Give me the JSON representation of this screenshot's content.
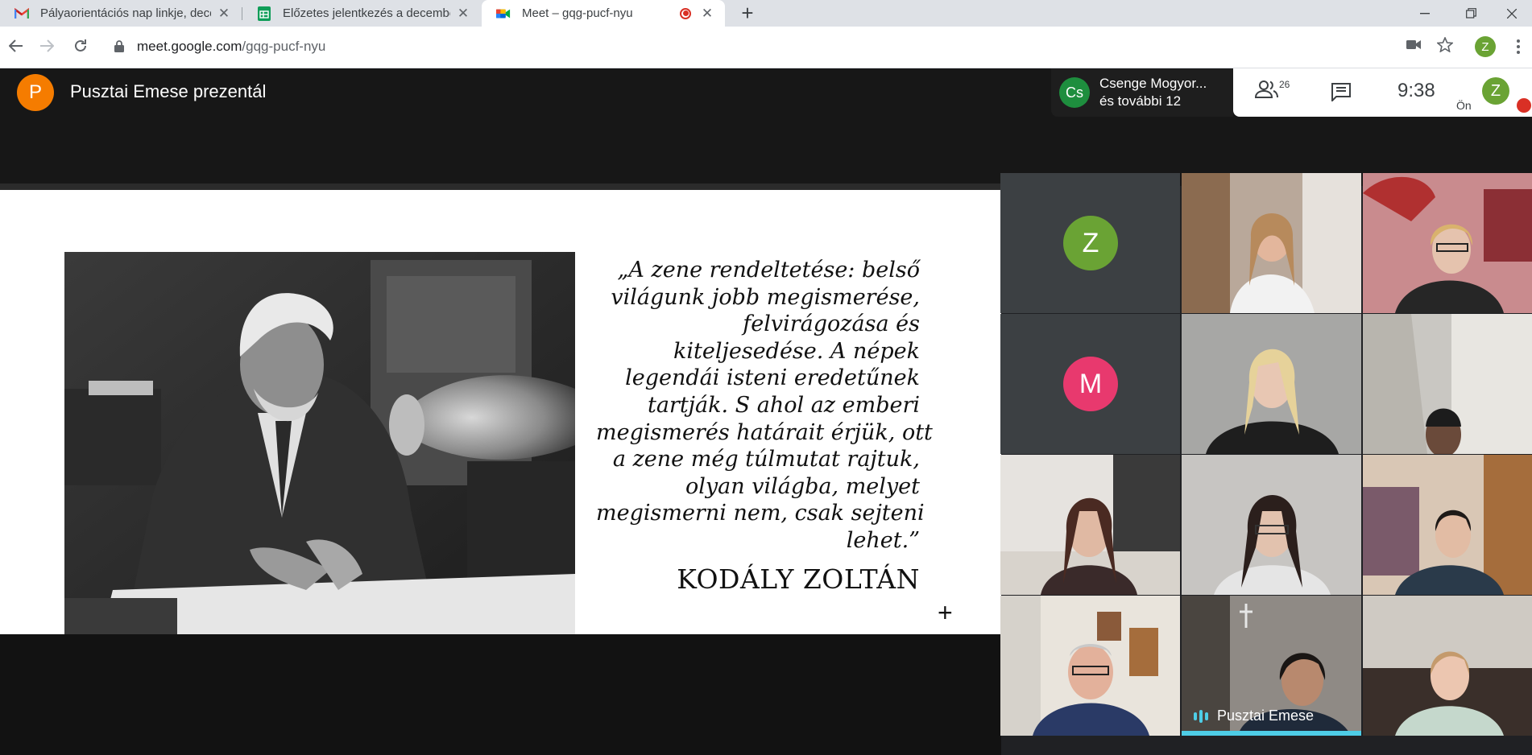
{
  "browser": {
    "tabs": [
      {
        "title": "Pályaorientációs nap linkje, decem",
        "favicon": "gmail-icon"
      },
      {
        "title": "Előzetes jelentkezés a december",
        "favicon": "sheets-icon"
      },
      {
        "title": "Meet – gqg-pucf-nyu",
        "favicon": "meet-icon",
        "recording": true,
        "active": true
      }
    ],
    "url_host": "meet.google.com",
    "url_path": "/gqg-pucf-nyu",
    "profile_initial": "Z"
  },
  "meet": {
    "presenter_initial": "P",
    "presenter_title": "Pusztai Emese prezentál",
    "chip": {
      "initials": "Cs",
      "line1": "Csenge Mogyor...",
      "line2": "és további 12"
    },
    "participant_count": "26",
    "time": "9:38",
    "you_label": "Ön",
    "self_initial": "Z"
  },
  "slide": {
    "quote_lines": [
      "„A zene rendeltetése: belső",
      "világunk jobb megismerése,",
      "felvirágozása és",
      "kiteljesedése. A népek",
      "legendái isteni eredetűnek",
      "tartják. S ahol az emberi",
      "megismerés határait érjük, ott",
      "a zene még túlmutat rajtuk,",
      "olyan világba, melyet",
      "megismerni nem, csak sejteni",
      "lehet.”"
    ],
    "author": "KODÁLY ZOLTÁN",
    "plus_glyph": "+"
  },
  "tiles": [
    {
      "type": "avatar",
      "initial": "Z",
      "color": "#6aa334"
    },
    {
      "type": "video"
    },
    {
      "type": "video"
    },
    {
      "type": "avatar",
      "initial": "M",
      "color": "#e8396e"
    },
    {
      "type": "video"
    },
    {
      "type": "video"
    },
    {
      "type": "video"
    },
    {
      "type": "video"
    },
    {
      "type": "video"
    },
    {
      "type": "video"
    },
    {
      "type": "video",
      "name": "Pusztai Emese",
      "speaking": true
    },
    {
      "type": "video"
    }
  ],
  "colors": {
    "meet_bg": "#202124",
    "speaking_bar": "#4ecde6",
    "record_red": "#d93025"
  }
}
